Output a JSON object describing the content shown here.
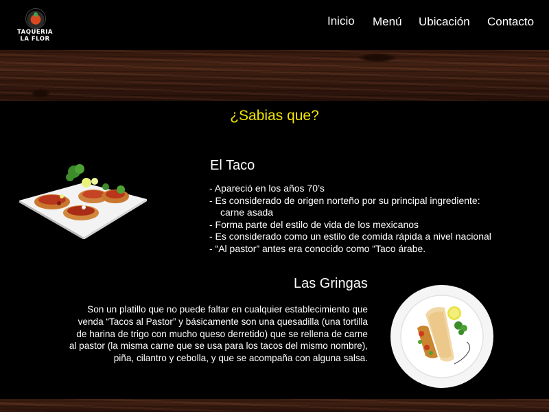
{
  "header": {
    "logo_line1": "TAQUERIA",
    "logo_line2": "LA FLOR",
    "nav": [
      "Inicio",
      "Menú",
      "Ubicación",
      "Contacto"
    ]
  },
  "main": {
    "heading": "¿Sabias que?",
    "taco": {
      "title": "El Taco",
      "items": [
        "- Apareció en los años 70’s",
        "- Es considerado de origen norteño por su principal ingrediente:",
        "carne asada",
        "- Forma parte del estilo de vida de los mexicanos",
        "- Es considerado como un estilo de comida rápida a nivel nacional",
        "- “Al pastor” antes era conocido como “Taco árabe."
      ]
    },
    "gringas": {
      "title": "Las Gringas",
      "text_lines": [
        "Son un platillo que no puede faltar en cualquier establecimiento que",
        "venda “Tacos al Pastor” y básicamente son una quesadilla (una tortilla",
        "de harina de trigo con mucho queso derretido) que se rellena de carne",
        "al pastor (la misma carne que se usa para los tacos del mismo nombre),",
        "piña, cilantro y cebolla, y que se acompaña con alguna salsa."
      ]
    }
  },
  "colors": {
    "heading": "#f4e600",
    "background": "#000000",
    "text": "#ffffff"
  }
}
